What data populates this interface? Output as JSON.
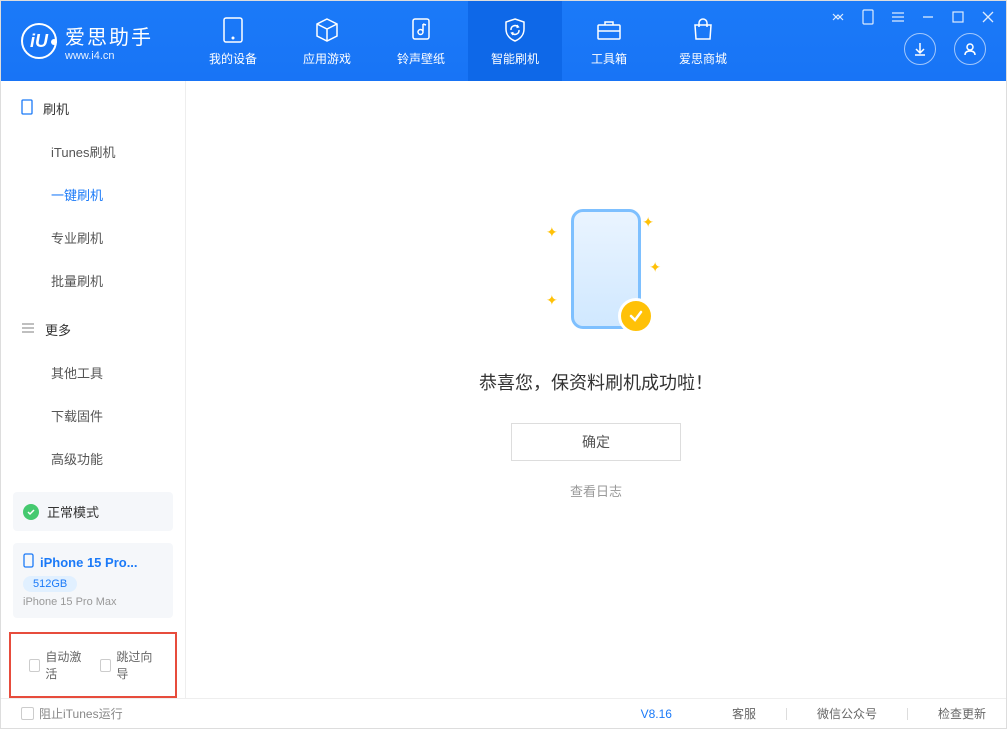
{
  "app": {
    "title": "爱思助手",
    "subtitle": "www.i4.cn",
    "logo_letter": "iU"
  },
  "nav": {
    "tabs": [
      {
        "label": "我的设备"
      },
      {
        "label": "应用游戏"
      },
      {
        "label": "铃声壁纸"
      },
      {
        "label": "智能刷机"
      },
      {
        "label": "工具箱"
      },
      {
        "label": "爱思商城"
      }
    ]
  },
  "sidebar": {
    "group1": {
      "title": "刷机",
      "items": [
        {
          "label": "iTunes刷机"
        },
        {
          "label": "一键刷机"
        },
        {
          "label": "专业刷机"
        },
        {
          "label": "批量刷机"
        }
      ]
    },
    "group2": {
      "title": "更多",
      "items": [
        {
          "label": "其他工具"
        },
        {
          "label": "下载固件"
        },
        {
          "label": "高级功能"
        }
      ]
    },
    "status": {
      "label": "正常模式"
    },
    "device": {
      "name": "iPhone 15 Pro...",
      "storage": "512GB",
      "model": "iPhone 15 Pro Max"
    },
    "checks": {
      "auto_activate": "自动激活",
      "skip_wizard": "跳过向导"
    }
  },
  "main": {
    "success_message": "恭喜您，保资料刷机成功啦！",
    "ok_button": "确定",
    "view_log": "查看日志"
  },
  "footer": {
    "block_itunes": "阻止iTunes运行",
    "version": "V8.16",
    "links": [
      "客服",
      "微信公众号",
      "检查更新"
    ]
  }
}
